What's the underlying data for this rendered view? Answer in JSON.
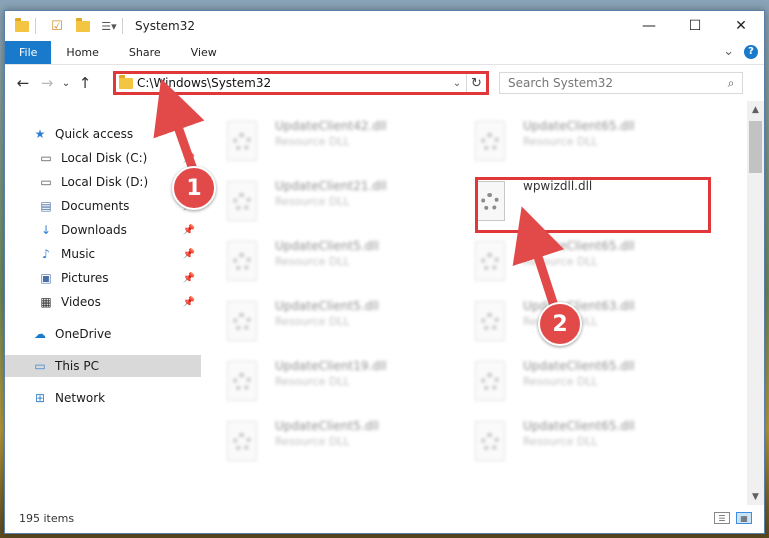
{
  "window": {
    "title": "System32",
    "controls": {
      "minimize": "—",
      "maximize": "☐",
      "close": "✕"
    }
  },
  "ribbon": {
    "tabs": [
      "File",
      "Home",
      "Share",
      "View"
    ],
    "expand_glyph": "⌄",
    "help_glyph": "?"
  },
  "navigation": {
    "back_glyph": "←",
    "forward_glyph": "→",
    "recent_glyph": "⌄",
    "up_glyph": "↑",
    "address": "C:\\Windows\\System32",
    "address_dropdown_glyph": "⌄",
    "refresh_glyph": "↻",
    "search_placeholder": "Search System32",
    "search_glyph": "⌕"
  },
  "sidebar": {
    "items": [
      {
        "label": "Quick access",
        "icon": "star-icon",
        "glyph": "★",
        "color": "#2d7fd6",
        "pinned": false
      },
      {
        "label": "Local Disk (C:)",
        "icon": "drive-icon",
        "glyph": "▭",
        "color": "#555555",
        "pinned": true
      },
      {
        "label": "Local Disk (D:)",
        "icon": "drive-icon",
        "glyph": "▭",
        "color": "#555555",
        "pinned": false
      },
      {
        "label": "Documents",
        "icon": "document-icon",
        "glyph": "▤",
        "color": "#4a6fa5",
        "pinned": true
      },
      {
        "label": "Downloads",
        "icon": "download-icon",
        "glyph": "↓",
        "color": "#2d7fd6",
        "pinned": true
      },
      {
        "label": "Music",
        "icon": "music-icon",
        "glyph": "♪",
        "color": "#2d7fd6",
        "pinned": true
      },
      {
        "label": "Pictures",
        "icon": "picture-icon",
        "glyph": "▣",
        "color": "#4a6fa5",
        "pinned": true
      },
      {
        "label": "Videos",
        "icon": "video-icon",
        "glyph": "▦",
        "color": "#333333",
        "pinned": true
      },
      {
        "label": "OneDrive",
        "icon": "cloud-icon",
        "glyph": "☁",
        "color": "#1979ca",
        "pinned": false
      },
      {
        "label": "This PC",
        "icon": "computer-icon",
        "glyph": "▭",
        "color": "#3a86d0",
        "pinned": false,
        "selected": true
      },
      {
        "label": "Network",
        "icon": "network-icon",
        "glyph": "⊞",
        "color": "#3a86d0",
        "pinned": false
      }
    ],
    "pin_glyph": "📌"
  },
  "files": [
    {
      "name": "UpdateClient42.dll",
      "type": "Resource DLL",
      "blurred": true
    },
    {
      "name": "UpdateClient65.dll",
      "type": "Resource DLL",
      "blurred": true
    },
    {
      "name": "UpdateClient21.dll",
      "type": "Resource DLL",
      "blurred": true
    },
    {
      "name": "wpwizdll.dll",
      "type": "",
      "blurred": false
    },
    {
      "name": "UpdateClient5.dll",
      "type": "Resource DLL",
      "blurred": true
    },
    {
      "name": "UpdateClient65.dll",
      "type": "Resource DLL",
      "blurred": true
    },
    {
      "name": "UpdateClient5.dll",
      "type": "Resource DLL",
      "blurred": true
    },
    {
      "name": "UpdateClient63.dll",
      "type": "Resource DLL",
      "blurred": true
    },
    {
      "name": "UpdateClient19.dll",
      "type": "Resource DLL",
      "blurred": true
    },
    {
      "name": "UpdateClient65.dll",
      "type": "Resource DLL",
      "blurred": true
    },
    {
      "name": "UpdateClient5.dll",
      "type": "Resource DLL",
      "blurred": true
    },
    {
      "name": "UpdateClient65.dll",
      "type": "Resource DLL",
      "blurred": true
    }
  ],
  "status": {
    "item_count": "195 items"
  },
  "annotations": {
    "step1": "1",
    "step2": "2",
    "color": "#e24a4a"
  }
}
